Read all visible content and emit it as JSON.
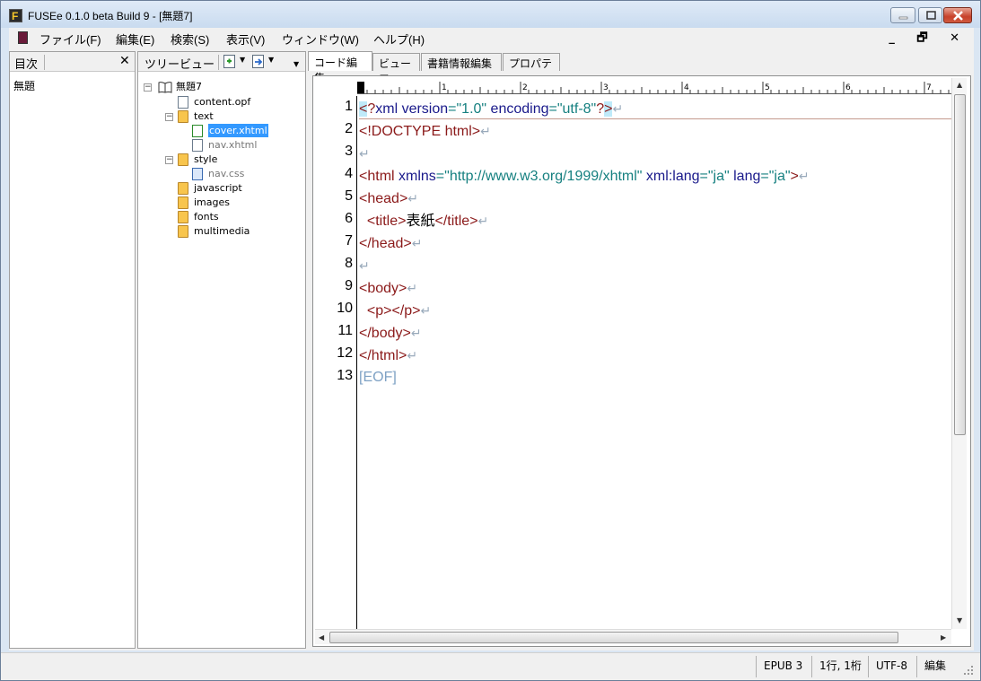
{
  "window": {
    "title": "FUSEe 0.1.0 beta Build 9 - [無題7]",
    "app_icon_letter": "F"
  },
  "menu": {
    "items": [
      "ファイル(F)",
      "編集(E)",
      "検索(S)",
      "表示(V)",
      "ウィンドウ(W)",
      "ヘルプ(H)"
    ],
    "mdi_buttons": "_ 🗗 ✕"
  },
  "toc": {
    "title": "目次",
    "close": "✕",
    "items": [
      "無題"
    ]
  },
  "tree": {
    "title": "ツリービュー",
    "root": "無題7",
    "nodes": {
      "content_opf": "content.opf",
      "text": "text",
      "cover_xhtml": "cover.xhtml",
      "nav_xhtml": "nav.xhtml",
      "style": "style",
      "nav_css": "nav.css",
      "javascript": "javascript",
      "images": "images",
      "fonts": "fonts",
      "multimedia": "multimedia"
    }
  },
  "tabs": [
    "コード編集",
    "ビューワ",
    "書籍情報編集",
    "プロパティ"
  ],
  "editor": {
    "line_numbers": [
      "1",
      "2",
      "3",
      "4",
      "5",
      "6",
      "7",
      "8",
      "9",
      "10",
      "11",
      "12",
      "13"
    ],
    "ruler_marks": [
      "1",
      "2",
      "3",
      "4",
      "5",
      "6",
      "7"
    ],
    "code": {
      "l1": {
        "open": "<",
        "q": "?",
        "xml": "xml ",
        "version": "version",
        "eq1": "=",
        "v1": "\"1.0\"",
        "enc": " encoding",
        "eq2": "=",
        "v2": "\"utf-8\"",
        "q2": "?",
        "close": ">"
      },
      "l2": "<!DOCTYPE html>",
      "l4": {
        "open": "<html ",
        "xmlns": "xmlns",
        "eq1": "=",
        "v1": "\"http://www.w3.org/1999/xhtml\"",
        "lang1": " xml:lang",
        "eq2": "=",
        "v2": "\"ja\"",
        "lang2": " lang",
        "eq3": "=",
        "v3": "\"ja\"",
        "close": ">"
      },
      "l5": "<head>",
      "l6": {
        "indent": "  ",
        "open": "<title>",
        "text": "表紙",
        "close": "</title>"
      },
      "l7": "</head>",
      "l9": "<body>",
      "l10": {
        "indent": "  ",
        "open": "<p>",
        "close": "</p>"
      },
      "l11": "</body>",
      "l12": "</html>",
      "l13": "[EOF]"
    },
    "return_mark": "↵"
  },
  "status": {
    "format": "EPUB 3",
    "position": "1行, 1桁",
    "encoding": "UTF-8",
    "mode": "編集"
  }
}
